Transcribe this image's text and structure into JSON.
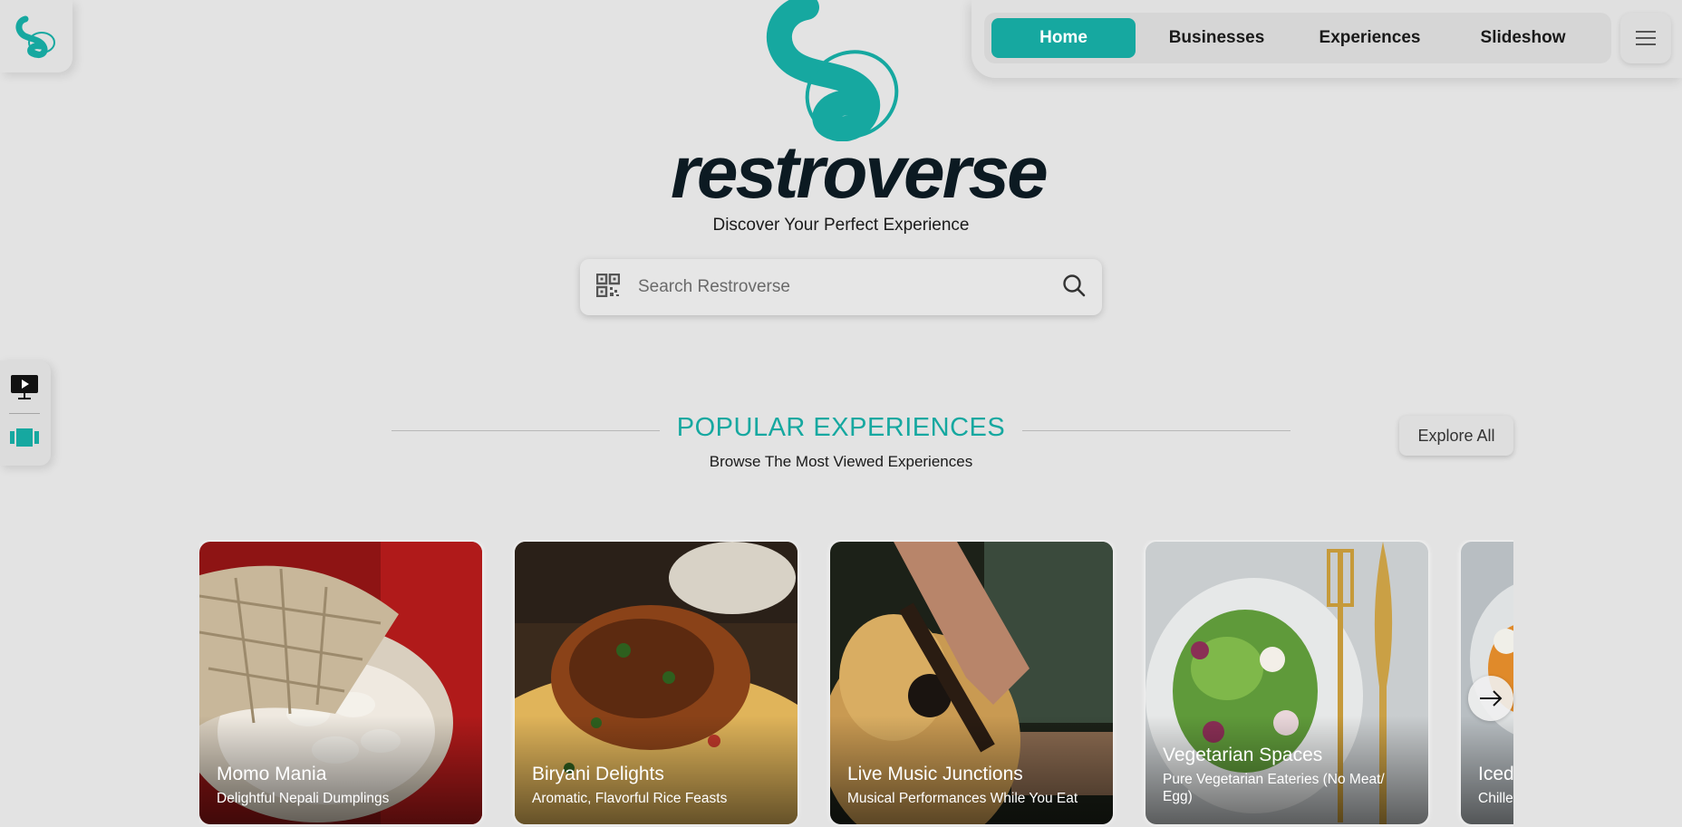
{
  "brand": {
    "name": "restroverse",
    "tagline": "Discover Your Perfect Experience",
    "accent_color": "#16a8a0",
    "dark_color": "#0c1a22"
  },
  "nav": {
    "tabs": [
      {
        "label": "Home",
        "active": true
      },
      {
        "label": "Businesses",
        "active": false
      },
      {
        "label": "Experiences",
        "active": false
      },
      {
        "label": "Slideshow",
        "active": false
      }
    ],
    "menu_icon": "hamburger-icon"
  },
  "side_tools": {
    "items": [
      {
        "icon": "slideshow-monitor-icon"
      },
      {
        "icon": "carousel-view-icon"
      }
    ]
  },
  "search": {
    "placeholder": "Search Restroverse",
    "value": "",
    "left_icon": "qr-code-icon",
    "right_icon": "search-icon"
  },
  "section": {
    "title": "POPULAR EXPERIENCES",
    "subtitle": "Browse The Most Viewed Experiences",
    "explore_label": "Explore All"
  },
  "cards": [
    {
      "title": "Momo Mania",
      "desc": "Delightful Nepali Dumplings"
    },
    {
      "title": "Biryani Delights",
      "desc": "Aromatic, Flavorful Rice Feasts"
    },
    {
      "title": "Live Music Junctions",
      "desc": "Musical Performances While You Eat"
    },
    {
      "title": "Vegetarian Spaces",
      "desc": "Pure Vegetarian Eateries (No Meat/ Egg)"
    },
    {
      "title": "Iced",
      "desc": "Chille"
    }
  ],
  "carousel_next_icon": "arrow-right-icon"
}
